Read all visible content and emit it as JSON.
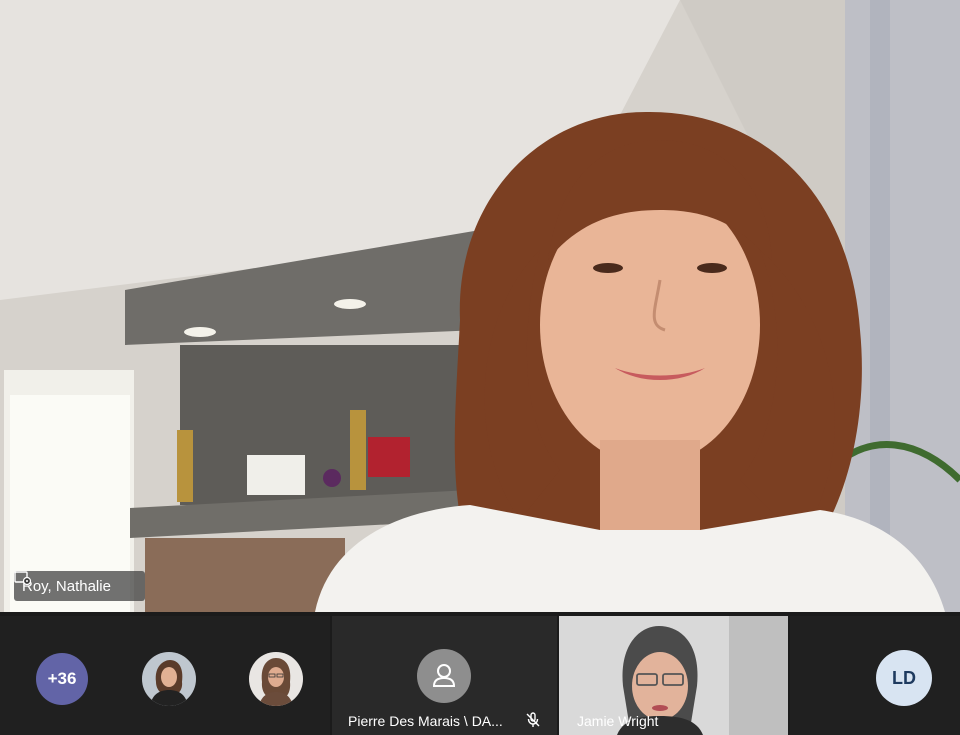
{
  "main_speaker": {
    "name": "Roy, Nathalie",
    "pin_icon": "pin-video-icon"
  },
  "participants_strip": {
    "overflow_count": "+36",
    "avatars": [
      {
        "icon": "participant-photo"
      },
      {
        "icon": "participant-photo"
      }
    ],
    "tiles": [
      {
        "name": "Pierre Des Marais \\ DA...",
        "icon": "person-icon",
        "mic": "mic-muted-icon"
      },
      {
        "name": "Jamie Wright",
        "icon": "video-feed"
      },
      {
        "initials": "LD"
      }
    ]
  },
  "colors": {
    "overflow_badge": "#6264a7",
    "initials_bg": "#d8e4f2",
    "initials_text": "#1e3a5f",
    "strip_bg": "#1b1b1b"
  }
}
